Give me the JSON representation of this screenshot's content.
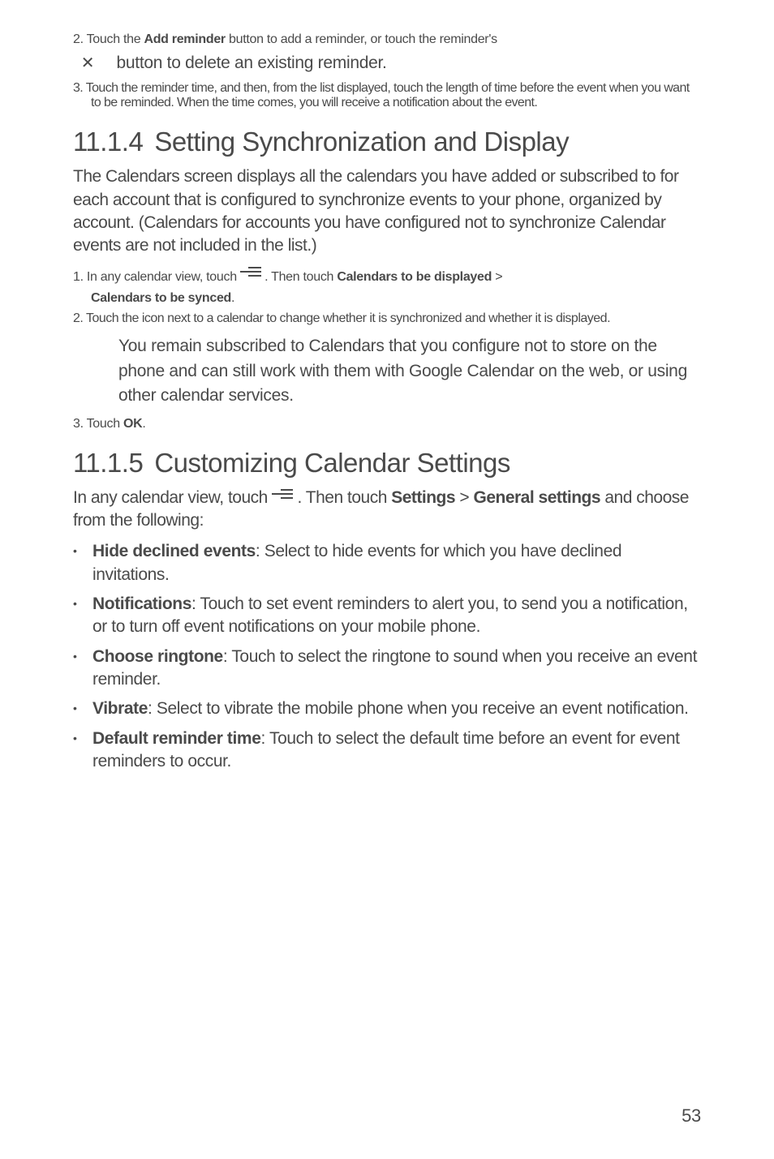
{
  "step2": {
    "num": "2.",
    "line1_pre": " Touch the ",
    "line1_bold": "Add reminder",
    "line1_post": " button to add a reminder, or touch the reminder's",
    "line2_post": " button to delete an existing reminder."
  },
  "step3": {
    "num": "3.",
    "text": " Touch the reminder time, and then, from the list displayed, touch the length of time before the event when you want to be reminded. When the time comes, you will receive a notification about the event."
  },
  "sec114": {
    "num": "11.1.4",
    "title": "Setting Synchronization and Display",
    "intro": "The Calendars screen displays all the calendars you have added or subscribed to for each account that is configured to synchronize events to your phone, organized by account. (Calendars for accounts you have configured not to synchronize Calendar events are not included in the list.)",
    "s1": {
      "num": "1.",
      "pre": " In any calendar view, touch ",
      "mid": " . Then touch ",
      "bold1": "Calendars to be displayed",
      "gt": " > ",
      "bold2": "Calendars to be synced",
      "end": "."
    },
    "s2": {
      "num": "2.",
      "text": " Touch the icon next to a calendar to change whether it is synchronized and whether it is displayed.",
      "note": "You remain subscribed to Calendars that you configure not to store on the phone and can still work with them with Google Calendar on the web, or using other calendar services."
    },
    "s3": {
      "num": "3.",
      "pre": " Touch ",
      "bold": "OK",
      "end": "."
    }
  },
  "sec115": {
    "num": "11.1.5",
    "title": "Customizing Calendar Settings",
    "intro_pre": "In any calendar view, touch ",
    "intro_mid": " . Then touch ",
    "intro_b1": "Settings",
    "intro_gt": " > ",
    "intro_b2": "General settings",
    "intro_post": " and choose from the following:",
    "items": {
      "i0": {
        "bold": "Hide declined events",
        "rest": ": Select to hide events for which you have declined invitations."
      },
      "i1": {
        "bold": "Notifications",
        "rest": ": Touch to set event reminders to alert you, to send you a notification, or to turn off event notifications on your mobile phone."
      },
      "i2": {
        "bold": "Choose ringtone",
        "rest": ": Touch to select the ringtone to sound when you receive an event reminder."
      },
      "i3": {
        "bold": "Vibrate",
        "rest": ": Select to vibrate the mobile phone when you receive an event notification."
      },
      "i4": {
        "bold": "Default reminder time",
        "rest": ": Touch to select the default time before an event for event reminders to occur."
      }
    }
  },
  "pageNumber": "53"
}
